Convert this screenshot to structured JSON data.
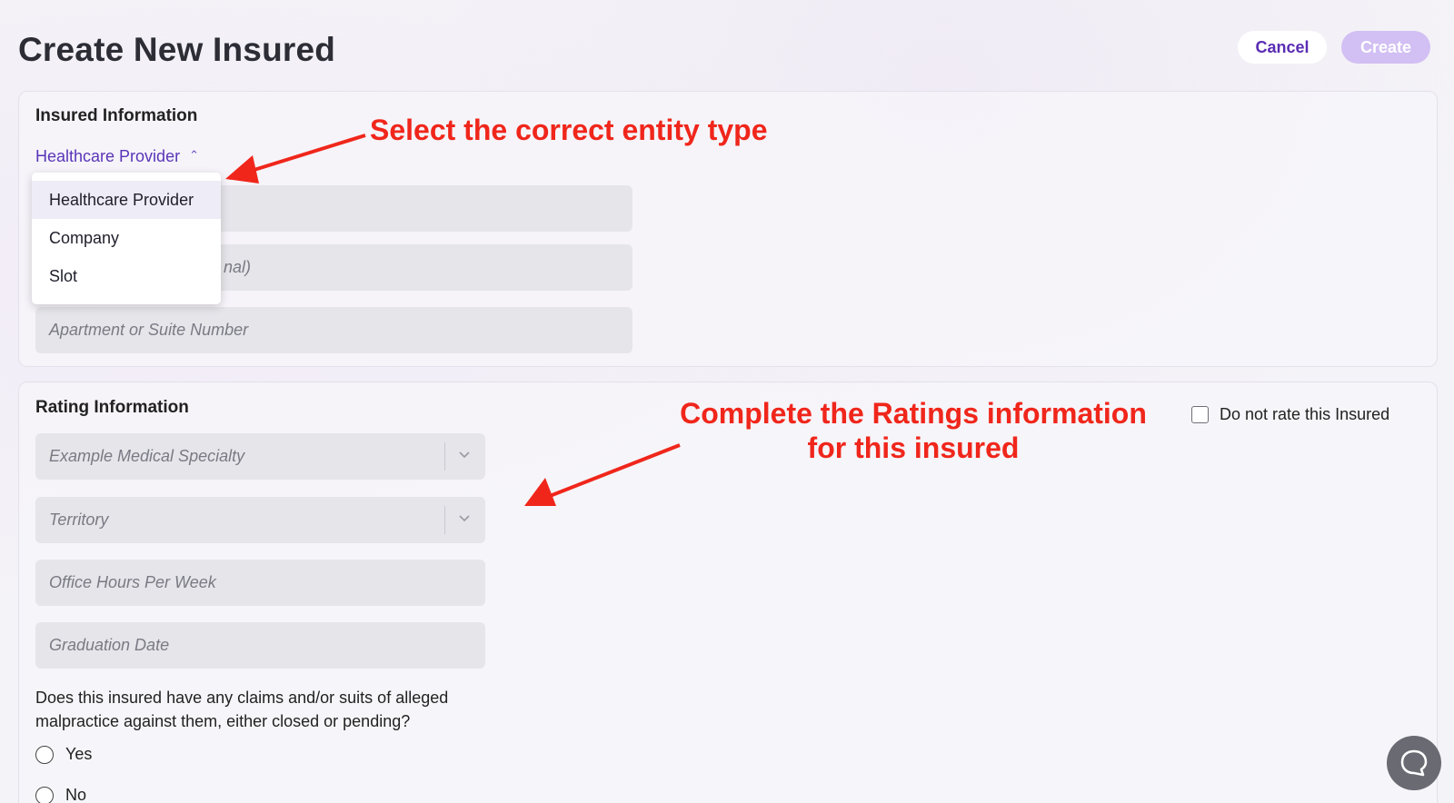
{
  "page": {
    "title": "Create New Insured"
  },
  "header": {
    "cancel_label": "Cancel",
    "create_label": "Create"
  },
  "insured_info": {
    "title": "Insured Information",
    "entity_type_selected": "Healthcare Provider",
    "dropdown_options": [
      "Healthcare Provider",
      "Company",
      "Slot"
    ],
    "partially_hidden_field_tail": "nal)",
    "apartment_placeholder": "Apartment or Suite Number"
  },
  "rating_info": {
    "title": "Rating Information",
    "specialty_placeholder": "Example Medical Specialty",
    "territory_placeholder": "Territory",
    "office_hours_placeholder": "Office Hours Per Week",
    "graduation_placeholder": "Graduation Date",
    "do_not_rate_label": "Do not rate this Insured",
    "claims_question": "Does this insured have any claims and/or suits of alleged malpractice against them, either closed or pending?",
    "yes_label": "Yes",
    "no_label": "No"
  },
  "annotations": {
    "entity_type_callout": "Select the correct entity type",
    "ratings_callout_line1": "Complete the Ratings information",
    "ratings_callout_line2": "for this insured"
  },
  "icons": {
    "entity_chevron": "chevron-up-icon",
    "select_chevron": "chevron-down-icon",
    "chat": "chat-bubble-icon"
  },
  "colors": {
    "accent": "#5a2cb3",
    "create_button_disabled": "#d2bff3",
    "annotation": "#f0261b",
    "field_bg": "#e6e5ea"
  }
}
